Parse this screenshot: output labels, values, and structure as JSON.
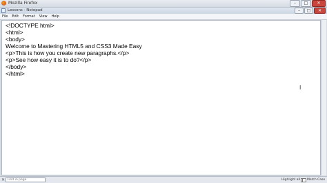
{
  "browser": {
    "title": "Mozilla Firefox",
    "controls": {
      "minimize": "–",
      "maximize": "□",
      "close": "✕"
    }
  },
  "notepad": {
    "title": "Lessons - Notepad",
    "controls": {
      "minimize": "–",
      "maximize": "□",
      "close": "✕"
    },
    "menu": [
      "File",
      "Edit",
      "Format",
      "View",
      "Help"
    ],
    "lines": [
      "<!DOCTYPE html>",
      "<html>",
      "<body>",
      "Welcome to Mastering HTML5 and CSS3 Made Easy",
      "<p>This is how you create new paragraphs.</p>",
      "<p>See how easy it is to do?</p>",
      "</body>",
      "</html>"
    ],
    "cursor_glyph": "I"
  },
  "findbar": {
    "close_glyph": "✕",
    "placeholder": "Find in page",
    "highlight_label": "Highlight all",
    "match_case_label": "Match Case"
  }
}
